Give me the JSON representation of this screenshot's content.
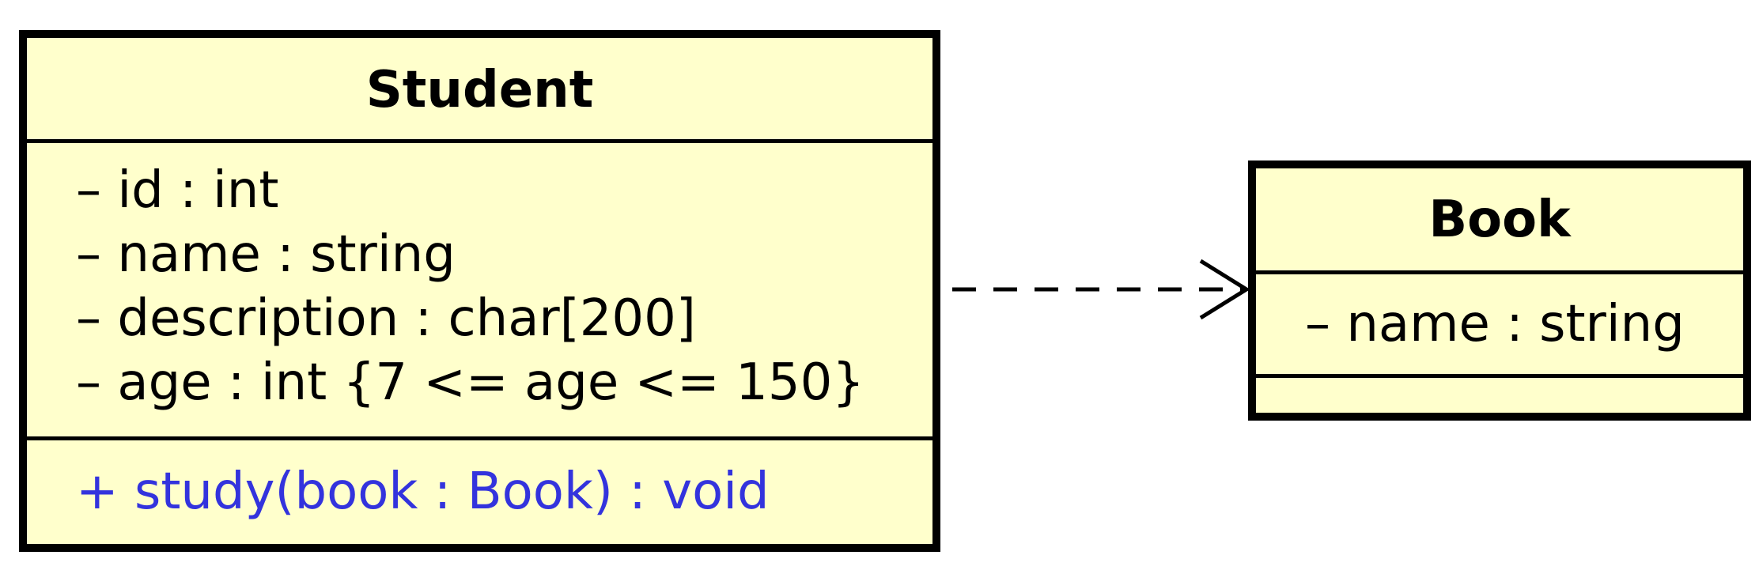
{
  "classes": {
    "student": {
      "name": "Student",
      "attributes": [
        "– id : int",
        "– name : string",
        "– description : char[200]",
        "– age : int {7 <= age <= 150}"
      ],
      "operations": [
        "+ study(book : Book) : void"
      ]
    },
    "book": {
      "name": "Book",
      "attributes": [
        "– name : string"
      ],
      "operations": []
    }
  },
  "relationship": {
    "type": "dependency",
    "style": "dashed-open-arrow"
  },
  "colors": {
    "class_fill": "#ffffcc",
    "border": "#000000",
    "operation_text": "#3333dd"
  }
}
